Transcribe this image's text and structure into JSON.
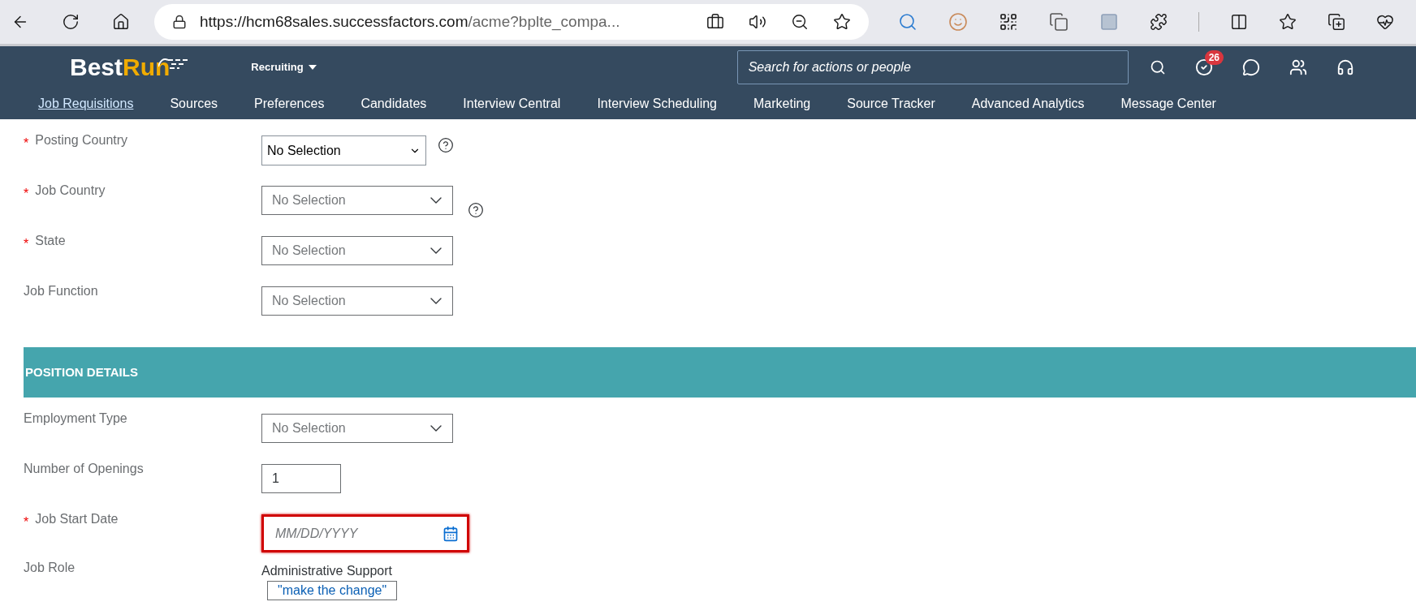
{
  "browser": {
    "url_host": "https://hcm68sales.successfactors.com",
    "url_rest": "/acme?bplte_compa..."
  },
  "header": {
    "logo": {
      "part1": "Best",
      "part2": "Run"
    },
    "module": "Recruiting",
    "search": {
      "placeholder": "Search for actions or people"
    },
    "notification_count": "26"
  },
  "nav": [
    {
      "label": "Job Requisitions",
      "selected": true
    },
    {
      "label": "Sources",
      "selected": false
    },
    {
      "label": "Preferences",
      "selected": false
    },
    {
      "label": "Candidates",
      "selected": false
    },
    {
      "label": "Interview Central",
      "selected": false
    },
    {
      "label": "Interview Scheduling",
      "selected": false
    },
    {
      "label": "Marketing",
      "selected": false
    },
    {
      "label": "Source Tracker",
      "selected": false
    },
    {
      "label": "Advanced Analytics",
      "selected": false
    },
    {
      "label": "Message Center",
      "selected": false
    }
  ],
  "form": [
    {
      "kind": "select",
      "required_mark": "*",
      "label": "Posting Country",
      "value": "No Selection",
      "help": true
    },
    {
      "kind": "combo",
      "required_mark": "*",
      "label": "Job Country",
      "placeholder": "No Selection",
      "help": true
    },
    {
      "kind": "combo",
      "required_mark": "*",
      "label": "State",
      "placeholder": "No Selection"
    },
    {
      "kind": "combo",
      "label": "Job Function",
      "placeholder": "No Selection"
    },
    {
      "kind": "section",
      "title": "POSITION DETAILS"
    },
    {
      "kind": "combo",
      "label": "Employment Type",
      "placeholder": "No Selection"
    },
    {
      "kind": "text",
      "label": "Number of Openings",
      "value": "1"
    },
    {
      "kind": "date",
      "required_mark": "*",
      "label": "Job Start Date",
      "placeholder": "MM/DD/YYYY",
      "error": true
    },
    {
      "kind": "readonly",
      "label": "Job Role",
      "value": "Administrative Support",
      "action": "\"make the change\""
    }
  ]
}
